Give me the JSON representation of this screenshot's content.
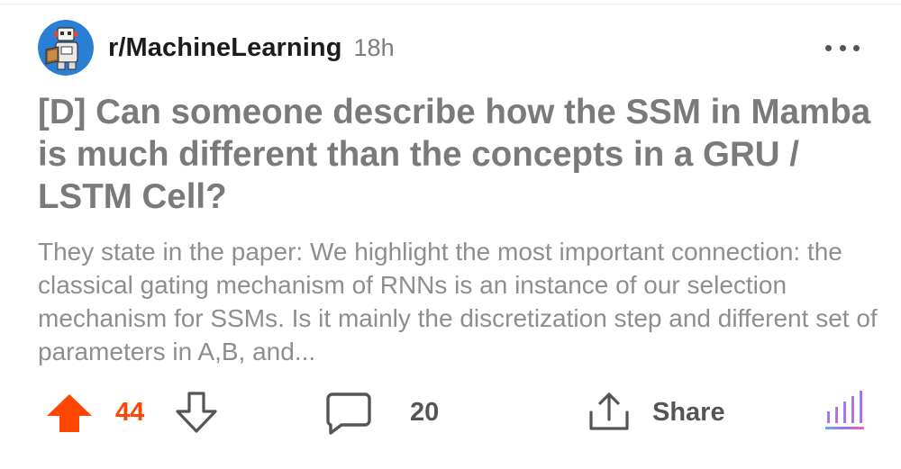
{
  "header": {
    "subreddit": "r/MachineLearning",
    "age": "18h",
    "more_icon": "more-horizontal-icon"
  },
  "post": {
    "title": "[D] Can someone describe how the SSM in Mamba is much different than the concepts in a GRU / LSTM Cell?",
    "body": "They state in the paper: We highlight the most important connection: the classical gating mechanism of RNNs is an instance of our selection mechanism for SSMs. Is it mainly the discretization step and different set of parameters in A,B, and..."
  },
  "actions": {
    "upvote_icon": "upvote-arrow-icon",
    "votes": "44",
    "downvote_icon": "downvote-arrow-icon",
    "comment_icon": "comment-bubble-icon",
    "comments": "20",
    "share_icon": "share-icon",
    "share_label": "Share",
    "insights_icon": "insights-bars-icon"
  },
  "colors": {
    "upvote_active": "#ff4500",
    "title": "#7a7a7a",
    "body": "#8e8e8e",
    "subreddit": "#1c1c1c"
  }
}
